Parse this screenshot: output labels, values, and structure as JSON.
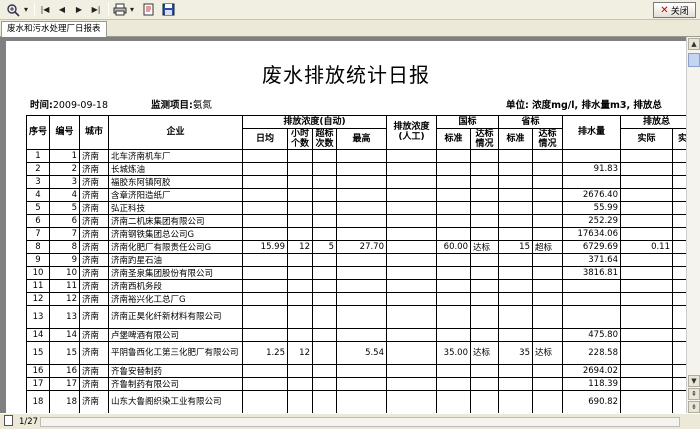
{
  "toolbar": {
    "zoom_icon": "zoom-icon",
    "first_icon": "first-page-icon",
    "prev_icon": "previous-page-icon",
    "next_icon": "next-page-icon",
    "last_icon": "last-page-icon",
    "print_icon": "print-icon",
    "export_icon": "export-icon",
    "save_icon": "save-icon",
    "close_label": "关闭"
  },
  "tab": {
    "label": "废水和污水处理厂日报表"
  },
  "report": {
    "title": "废水排放统计日报",
    "time_label": "时间:",
    "time_value": "2009-09-18",
    "item_label": "监测项目:",
    "item_value": "氨氮",
    "unit_text": "单位: 浓度mg/l,   排水量m3,   排放总"
  },
  "table": {
    "headers": {
      "seq": "序号",
      "code": "编号",
      "city": "城市",
      "company": "企业",
      "auto_group": "排放浓度(自动)",
      "avg": "日均",
      "hours": "小时个数",
      "over": "超标次数",
      "max": "最高",
      "manual": "排放浓度(人工)",
      "national_group": "国标",
      "nat_std": "标准",
      "nat_status": "达标情况",
      "provincial_group": "省标",
      "prov_std": "标准",
      "prov_status": "达标情况",
      "discharge": "排水量",
      "total_group": "排放总",
      "actual": "实际",
      "partial": "实"
    },
    "rows": [
      {
        "seq": "1",
        "code": "1",
        "city": "济南",
        "company": "北车济南机车厂",
        "avg": "",
        "hours": "",
        "over": "",
        "max": "",
        "manual": "",
        "nat_std": "",
        "nat_status": "",
        "prov_std": "",
        "prov_status": "",
        "discharge": "",
        "actual": ""
      },
      {
        "seq": "2",
        "code": "2",
        "city": "济南",
        "company": "长城炼油",
        "avg": "",
        "hours": "",
        "over": "",
        "max": "",
        "manual": "",
        "nat_std": "",
        "nat_status": "",
        "prov_std": "",
        "prov_status": "",
        "discharge": "91.83",
        "actual": ""
      },
      {
        "seq": "3",
        "code": "3",
        "city": "济南",
        "company": "福胶东阿镇阿胶",
        "avg": "",
        "hours": "",
        "over": "",
        "max": "",
        "manual": "",
        "nat_std": "",
        "nat_status": "",
        "prov_std": "",
        "prov_status": "",
        "discharge": "",
        "actual": ""
      },
      {
        "seq": "4",
        "code": "4",
        "city": "济南",
        "company": "含章济阳造纸厂",
        "avg": "",
        "hours": "",
        "over": "",
        "max": "",
        "manual": "",
        "nat_std": "",
        "nat_status": "",
        "prov_std": "",
        "prov_status": "",
        "discharge": "2676.40",
        "actual": ""
      },
      {
        "seq": "5",
        "code": "5",
        "city": "济南",
        "company": "弘正科技",
        "avg": "",
        "hours": "",
        "over": "",
        "max": "",
        "manual": "",
        "nat_std": "",
        "nat_status": "",
        "prov_std": "",
        "prov_status": "",
        "discharge": "55.99",
        "actual": ""
      },
      {
        "seq": "6",
        "code": "6",
        "city": "济南",
        "company": "济南二机床集团有限公司",
        "avg": "",
        "hours": "",
        "over": "",
        "max": "",
        "manual": "",
        "nat_std": "",
        "nat_status": "",
        "prov_std": "",
        "prov_status": "",
        "discharge": "252.29",
        "actual": ""
      },
      {
        "seq": "7",
        "code": "7",
        "city": "济南",
        "company": "济南钢铁集团总公司G",
        "avg": "",
        "hours": "",
        "over": "",
        "max": "",
        "manual": "",
        "nat_std": "",
        "nat_status": "",
        "prov_std": "",
        "prov_status": "",
        "discharge": "17634.06",
        "actual": ""
      },
      {
        "seq": "8",
        "code": "8",
        "city": "济南",
        "company": "济南化肥厂有限责任公司G",
        "avg": "15.99",
        "hours": "12",
        "over": "5",
        "max": "27.70",
        "manual": "",
        "nat_std": "60.00",
        "nat_status": "达标",
        "prov_std": "15",
        "prov_status": "超标",
        "discharge": "6729.69",
        "actual": "0.11"
      },
      {
        "seq": "9",
        "code": "9",
        "city": "济南",
        "company": "济南趵星石油",
        "avg": "",
        "hours": "",
        "over": "",
        "max": "",
        "manual": "",
        "nat_std": "",
        "nat_status": "",
        "prov_std": "",
        "prov_status": "",
        "discharge": "371.64",
        "actual": ""
      },
      {
        "seq": "10",
        "code": "10",
        "city": "济南",
        "company": "济南圣泉集团股份有限公司",
        "avg": "",
        "hours": "",
        "over": "",
        "max": "",
        "manual": "",
        "nat_std": "",
        "nat_status": "",
        "prov_std": "",
        "prov_status": "",
        "discharge": "3816.81",
        "actual": ""
      },
      {
        "seq": "11",
        "code": "11",
        "city": "济南",
        "company": "济南西机务段",
        "avg": "",
        "hours": "",
        "over": "",
        "max": "",
        "manual": "",
        "nat_std": "",
        "nat_status": "",
        "prov_std": "",
        "prov_status": "",
        "discharge": "",
        "actual": ""
      },
      {
        "seq": "12",
        "code": "12",
        "city": "济南",
        "company": "济南裕兴化工总厂G",
        "avg": "",
        "hours": "",
        "over": "",
        "max": "",
        "manual": "",
        "nat_std": "",
        "nat_status": "",
        "prov_std": "",
        "prov_status": "",
        "discharge": "",
        "actual": ""
      },
      {
        "seq": "13",
        "code": "13",
        "city": "济南",
        "company": "济南正昊化纤新材料有限公司",
        "avg": "",
        "hours": "",
        "over": "",
        "max": "",
        "manual": "",
        "nat_std": "",
        "nat_status": "",
        "prov_std": "",
        "prov_status": "",
        "discharge": "",
        "actual": ""
      },
      {
        "seq": "14",
        "code": "14",
        "city": "济南",
        "company": "卢堡啤酒有限公司",
        "avg": "",
        "hours": "",
        "over": "",
        "max": "",
        "manual": "",
        "nat_std": "",
        "nat_status": "",
        "prov_std": "",
        "prov_status": "",
        "discharge": "475.80",
        "actual": ""
      },
      {
        "seq": "15",
        "code": "15",
        "city": "济南",
        "company": "平阴鲁西化工第三化肥厂有限公司",
        "avg": "1.25",
        "hours": "12",
        "over": "",
        "max": "5.54",
        "manual": "",
        "nat_std": "35.00",
        "nat_status": "达标",
        "prov_std": "35",
        "prov_status": "达标",
        "discharge": "228.58",
        "actual": ""
      },
      {
        "seq": "16",
        "code": "16",
        "city": "济南",
        "company": "齐鲁安替制药",
        "avg": "",
        "hours": "",
        "over": "",
        "max": "",
        "manual": "",
        "nat_std": "",
        "nat_status": "",
        "prov_std": "",
        "prov_status": "",
        "discharge": "2694.02",
        "actual": ""
      },
      {
        "seq": "17",
        "code": "17",
        "city": "济南",
        "company": "齐鲁制药有限公司",
        "avg": "",
        "hours": "",
        "over": "",
        "max": "",
        "manual": "",
        "nat_std": "",
        "nat_status": "",
        "prov_std": "",
        "prov_status": "",
        "discharge": "118.39",
        "actual": ""
      },
      {
        "seq": "18",
        "code": "18",
        "city": "济南",
        "company": "山东大鲁阁织染工业有限公司",
        "avg": "",
        "hours": "",
        "over": "",
        "max": "",
        "manual": "",
        "nat_std": "",
        "nat_status": "",
        "prov_std": "",
        "prov_status": "",
        "discharge": "690.82",
        "actual": ""
      }
    ]
  },
  "status": {
    "page_icon": "page-icon",
    "page_indicator": "1/27"
  }
}
